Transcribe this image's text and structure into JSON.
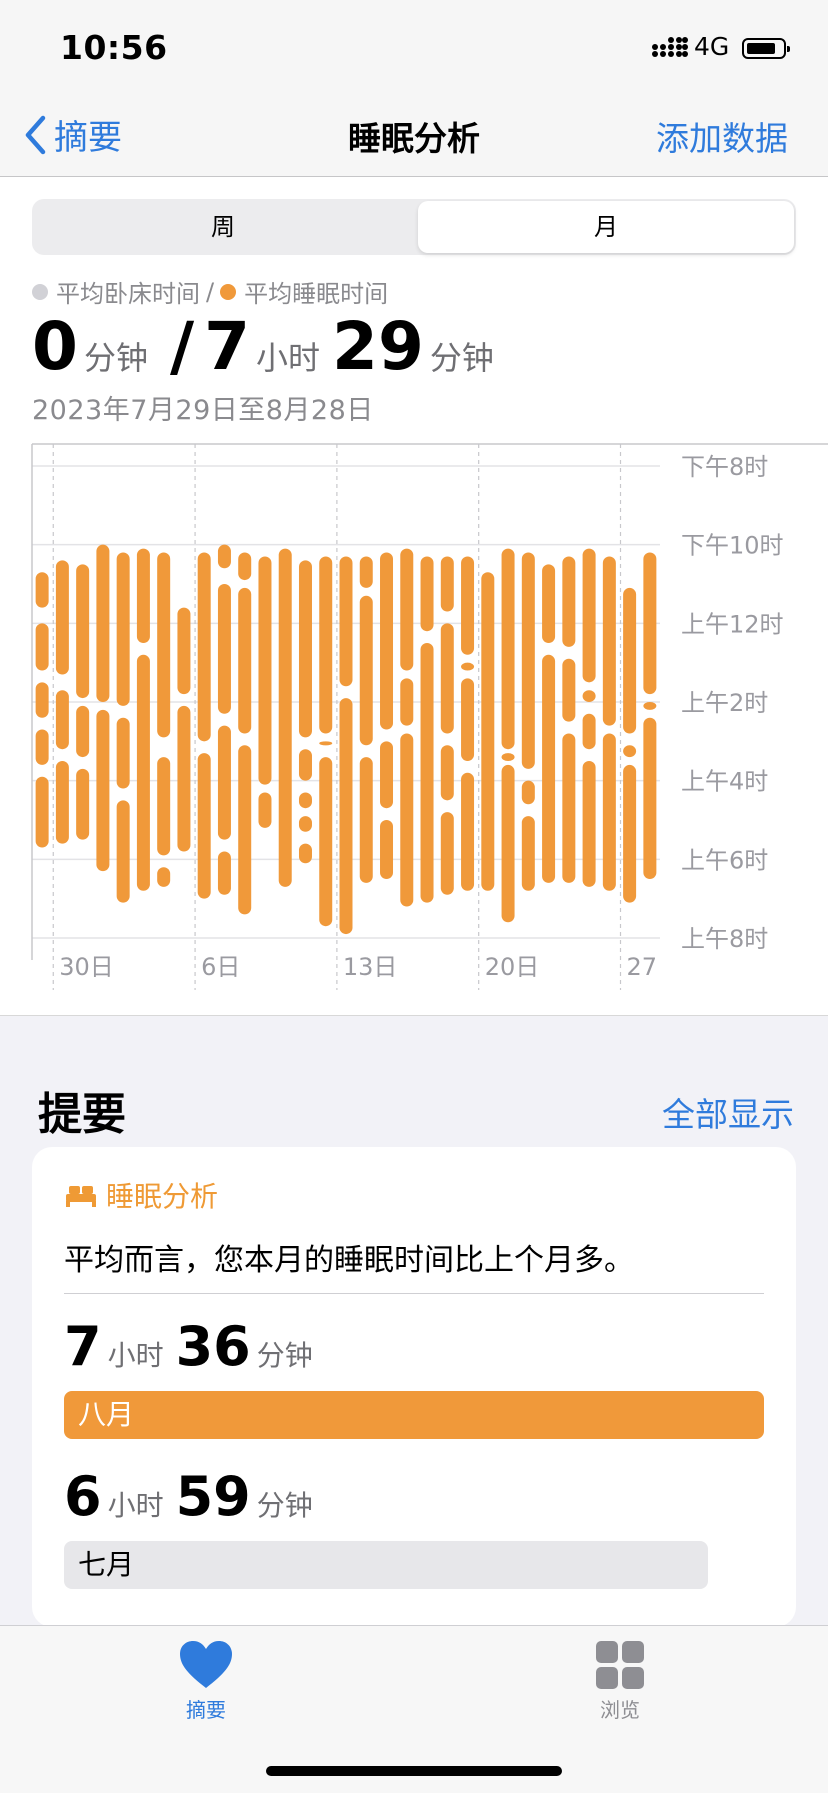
{
  "status": {
    "time": "10:56",
    "network": "4G",
    "battery_level": 0.85
  },
  "nav": {
    "back_label": "摘要",
    "title": "睡眠分析",
    "action_label": "添加数据"
  },
  "segment": {
    "options": [
      "周",
      "月"
    ],
    "selected": "月"
  },
  "legend": {
    "in_bed_label": "平均卧床时间",
    "separator": "/",
    "asleep_label": "平均睡眠时间",
    "in_bed_color": "#d1d1d6",
    "asleep_color": "#f0993a"
  },
  "summary": {
    "in_bed_value": "0",
    "in_bed_unit": "分钟",
    "slash": "/",
    "asleep_hours": "7",
    "hours_unit": "小时",
    "asleep_minutes": "29",
    "minutes_unit": "分钟",
    "date_range": "2023年7月29日至8月28日"
  },
  "chart_data": {
    "type": "range-bar",
    "x_tick_labels": [
      "30日",
      "6日",
      "13日",
      "20日",
      "27"
    ],
    "y_tick_labels": [
      "下午8时",
      "下午10时",
      "上午12时",
      "上午2时",
      "上午4时",
      "上午6时",
      "上午8时"
    ],
    "y_range_hours_from_8pm": [
      0,
      12
    ],
    "series": [
      {
        "color": "#f0993a",
        "days": [
          {
            "segments": [
              [
                2.7,
                3.6
              ],
              [
                4.0,
                5.2
              ],
              [
                5.5,
                6.4
              ],
              [
                6.7,
                7.6
              ],
              [
                7.9,
                9.7
              ]
            ]
          },
          {
            "segments": [
              [
                2.4,
                5.3
              ],
              [
                5.7,
                7.2
              ],
              [
                7.5,
                9.6
              ]
            ]
          },
          {
            "segments": [
              [
                2.5,
                5.9
              ],
              [
                6.1,
                7.4
              ],
              [
                7.7,
                9.5
              ]
            ]
          },
          {
            "segments": [
              [
                2.0,
                6.0
              ],
              [
                6.2,
                10.3
              ]
            ]
          },
          {
            "segments": [
              [
                2.2,
                6.1
              ],
              [
                6.4,
                8.2
              ],
              [
                8.5,
                11.1
              ]
            ]
          },
          {
            "segments": [
              [
                2.1,
                4.5
              ],
              [
                4.8,
                10.8
              ]
            ]
          },
          {
            "segments": [
              [
                2.2,
                6.9
              ],
              [
                7.4,
                9.9
              ],
              [
                10.2,
                10.7
              ]
            ]
          },
          {
            "segments": [
              [
                3.6,
                5.8
              ],
              [
                6.1,
                9.8
              ]
            ]
          },
          {
            "segments": [
              [
                2.2,
                7.0
              ],
              [
                7.3,
                11.0
              ]
            ]
          },
          {
            "segments": [
              [
                2.0,
                2.6
              ],
              [
                3.0,
                6.3
              ],
              [
                6.6,
                9.5
              ],
              [
                9.8,
                10.9
              ]
            ]
          },
          {
            "segments": [
              [
                2.2,
                2.9
              ],
              [
                3.1,
                6.8
              ],
              [
                7.1,
                11.4
              ]
            ]
          },
          {
            "segments": [
              [
                2.3,
                8.1
              ],
              [
                8.3,
                9.2
              ]
            ]
          },
          {
            "segments": [
              [
                2.1,
                10.7
              ]
            ]
          },
          {
            "segments": [
              [
                2.4,
                6.9
              ],
              [
                7.2,
                8.0
              ],
              [
                8.3,
                8.7
              ],
              [
                8.9,
                9.3
              ],
              [
                9.6,
                10.1
              ]
            ]
          },
          {
            "segments": [
              [
                2.3,
                6.8
              ],
              [
                7.0,
                7.1
              ],
              [
                7.4,
                11.7
              ]
            ]
          },
          {
            "segments": [
              [
                2.3,
                5.6
              ],
              [
                5.9,
                11.9
              ]
            ]
          },
          {
            "segments": [
              [
                2.3,
                3.1
              ],
              [
                3.3,
                7.1
              ],
              [
                7.4,
                10.6
              ]
            ]
          },
          {
            "segments": [
              [
                2.2,
                6.7
              ],
              [
                7.0,
                8.7
              ],
              [
                9.0,
                10.5
              ]
            ]
          },
          {
            "segments": [
              [
                2.1,
                5.2
              ],
              [
                5.4,
                6.6
              ],
              [
                6.8,
                11.2
              ]
            ]
          },
          {
            "segments": [
              [
                2.3,
                4.2
              ],
              [
                4.5,
                11.1
              ]
            ]
          },
          {
            "segments": [
              [
                2.3,
                3.7
              ],
              [
                4.0,
                6.8
              ],
              [
                7.1,
                8.5
              ],
              [
                8.8,
                10.9
              ]
            ]
          },
          {
            "segments": [
              [
                2.3,
                4.8
              ],
              [
                5.0,
                5.2
              ],
              [
                5.4,
                7.5
              ],
              [
                7.8,
                10.8
              ]
            ]
          },
          {
            "segments": [
              [
                2.7,
                10.8
              ]
            ]
          },
          {
            "segments": [
              [
                2.1,
                7.2
              ],
              [
                7.3,
                7.5
              ],
              [
                7.6,
                11.6
              ]
            ]
          },
          {
            "segments": [
              [
                2.2,
                7.7
              ],
              [
                8.0,
                8.6
              ],
              [
                8.9,
                10.8
              ]
            ]
          },
          {
            "segments": [
              [
                2.5,
                4.5
              ],
              [
                4.8,
                10.6
              ]
            ]
          },
          {
            "segments": [
              [
                2.3,
                4.6
              ],
              [
                4.9,
                6.5
              ],
              [
                6.8,
                10.6
              ]
            ]
          },
          {
            "segments": [
              [
                2.1,
                5.5
              ],
              [
                5.7,
                6.0
              ],
              [
                6.3,
                7.2
              ],
              [
                7.5,
                10.7
              ]
            ]
          },
          {
            "segments": [
              [
                2.3,
                6.6
              ],
              [
                6.8,
                10.8
              ]
            ]
          },
          {
            "segments": [
              [
                3.1,
                6.8
              ],
              [
                7.1,
                7.4
              ],
              [
                7.6,
                11.1
              ]
            ]
          },
          {
            "segments": [
              [
                2.2,
                5.8
              ],
              [
                6.0,
                6.2
              ],
              [
                6.4,
                10.5
              ]
            ]
          }
        ]
      }
    ]
  },
  "highlights": {
    "title": "提要",
    "show_all_label": "全部显示",
    "card": {
      "category_icon": "bed-icon",
      "category_label": "睡眠分析",
      "message": "平均而言，您本月的睡眠时间比上个月多。",
      "current": {
        "hours": "7",
        "hours_unit": "小时",
        "minutes": "36",
        "minutes_unit": "分钟",
        "month": "八月",
        "fraction": 1.0,
        "color": "#f0993a"
      },
      "previous": {
        "hours": "6",
        "hours_unit": "小时",
        "minutes": "59",
        "minutes_unit": "分钟",
        "month": "七月",
        "fraction": 0.92,
        "color": "#e7e7ea"
      }
    }
  },
  "tabbar": {
    "items": [
      {
        "label": "摘要",
        "icon": "heart-icon",
        "active": true
      },
      {
        "label": "浏览",
        "icon": "grid-icon",
        "active": false
      }
    ]
  }
}
